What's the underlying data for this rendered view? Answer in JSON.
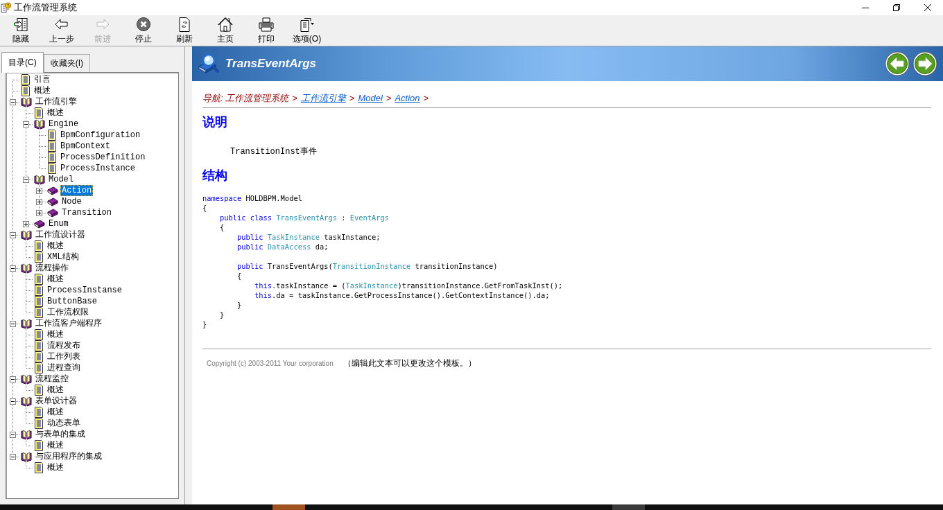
{
  "window": {
    "title": "工作流管理系统"
  },
  "toolbar": [
    {
      "label": "隐藏",
      "kind": "hide",
      "disabled": false
    },
    {
      "label": "上一步",
      "kind": "back",
      "disabled": false
    },
    {
      "label": "前进",
      "kind": "forward",
      "disabled": true
    },
    {
      "label": "停止",
      "kind": "stop",
      "disabled": false
    },
    {
      "label": "刷新",
      "kind": "refresh",
      "disabled": false
    },
    {
      "label": "主页",
      "kind": "home",
      "disabled": false
    },
    {
      "label": "打印",
      "kind": "print",
      "disabled": false
    },
    {
      "label": "选项(O)",
      "kind": "options",
      "disabled": false
    }
  ],
  "nav": {
    "tabs": [
      {
        "label": "目录(C)",
        "selected": true
      },
      {
        "label": "收藏夹(I)",
        "selected": false
      }
    ],
    "tree": [
      {
        "label": "引言",
        "kind": "page",
        "selected": false
      },
      {
        "label": "概述",
        "kind": "page",
        "selected": false
      },
      {
        "label": "工作流引擎",
        "kind": "book",
        "expanded": true,
        "selected": false,
        "children": [
          {
            "label": "概述",
            "kind": "page",
            "selected": false
          },
          {
            "label": "Engine",
            "kind": "book",
            "expanded": true,
            "selected": false,
            "children": [
              {
                "label": "BpmConfiguration",
                "kind": "page",
                "selected": false
              },
              {
                "label": "BpmContext",
                "kind": "page",
                "selected": false
              },
              {
                "label": "ProcessDefinition",
                "kind": "page",
                "selected": false
              },
              {
                "label": "ProcessInstance",
                "kind": "page",
                "selected": false
              }
            ]
          },
          {
            "label": "Model",
            "kind": "book",
            "expanded": true,
            "selected": false,
            "children": [
              {
                "label": "Action",
                "kind": "book",
                "expanded": false,
                "selected": true
              },
              {
                "label": "Node",
                "kind": "book",
                "expanded": false,
                "selected": false
              },
              {
                "label": "Transition",
                "kind": "book",
                "expanded": false,
                "selected": false
              }
            ]
          },
          {
            "label": "Enum",
            "kind": "book",
            "expanded": false,
            "selected": false
          }
        ]
      },
      {
        "label": "工作流设计器",
        "kind": "book",
        "expanded": true,
        "selected": false,
        "children": [
          {
            "label": "概述",
            "kind": "page",
            "selected": false
          },
          {
            "label": "XML结构",
            "kind": "page",
            "selected": false
          }
        ]
      },
      {
        "label": "流程操作",
        "kind": "book",
        "expanded": true,
        "selected": false,
        "children": [
          {
            "label": "概述",
            "kind": "page",
            "selected": false
          },
          {
            "label": "ProcessInstanse",
            "kind": "page",
            "selected": false
          },
          {
            "label": "ButtonBase",
            "kind": "page",
            "selected": false
          },
          {
            "label": "工作流权限",
            "kind": "page",
            "selected": false
          }
        ]
      },
      {
        "label": "工作流客户端程序",
        "kind": "book",
        "expanded": true,
        "selected": false,
        "children": [
          {
            "label": "概述",
            "kind": "page",
            "selected": false
          },
          {
            "label": "流程发布",
            "kind": "page",
            "selected": false
          },
          {
            "label": "工作列表",
            "kind": "page",
            "selected": false
          },
          {
            "label": "进程查询",
            "kind": "page",
            "selected": false
          }
        ]
      },
      {
        "label": "流程监控",
        "kind": "book",
        "expanded": true,
        "selected": false,
        "children": [
          {
            "label": "概述",
            "kind": "page",
            "selected": false
          }
        ]
      },
      {
        "label": "表单设计器",
        "kind": "book",
        "expanded": true,
        "selected": false,
        "children": [
          {
            "label": "概述",
            "kind": "page",
            "selected": false
          },
          {
            "label": "动态表单",
            "kind": "page",
            "selected": false
          }
        ]
      },
      {
        "label": "与表单的集成",
        "kind": "book",
        "expanded": true,
        "selected": false,
        "children": [
          {
            "label": "概述",
            "kind": "page",
            "selected": false
          }
        ]
      },
      {
        "label": "与应用程序的集成",
        "kind": "book",
        "expanded": true,
        "selected": false,
        "children": [
          {
            "label": "概述",
            "kind": "page",
            "selected": false
          }
        ]
      }
    ]
  },
  "topic": {
    "title": "TransEventArgs",
    "breadcrumb": [
      {
        "text": "导航: 工作流管理系统",
        "kind": "text"
      },
      {
        "text": ">",
        "kind": "separator"
      },
      {
        "text": "工作流引擎",
        "kind": "link"
      },
      {
        "text": ">",
        "kind": "separator"
      },
      {
        "text": "Model",
        "kind": "link"
      },
      {
        "text": ">",
        "kind": "separator"
      },
      {
        "text": "Action",
        "kind": "link"
      },
      {
        "text": ">",
        "kind": "separator"
      }
    ],
    "sections": [
      {
        "heading": "说明",
        "kind": "text",
        "text": "TransitionInst事件"
      },
      {
        "heading": "结构",
        "kind": "code",
        "lines": [
          {
            "kind": "code",
            "tokens": [
              {
                "t": "namespace",
                "kind": "keyword"
              },
              {
                "t": " HOLDBPM.Model",
                "kind": "plain"
              }
            ]
          },
          {
            "kind": "code",
            "tokens": [
              {
                "t": "{",
                "kind": "plain"
              }
            ]
          },
          {
            "kind": "code",
            "tokens": [
              {
                "t": "    public class",
                "kind": "keyword"
              },
              {
                "t": " TransEventArgs",
                "kind": "type"
              },
              {
                "t": " : ",
                "kind": "plain"
              },
              {
                "t": "EventArgs",
                "kind": "type"
              }
            ]
          },
          {
            "kind": "code",
            "tokens": [
              {
                "t": "    {",
                "kind": "plain"
              }
            ]
          },
          {
            "kind": "code",
            "tokens": [
              {
                "t": "        public",
                "kind": "keyword"
              },
              {
                "t": " TaskInstance",
                "kind": "type"
              },
              {
                "t": " taskInstance;",
                "kind": "plain"
              }
            ]
          },
          {
            "kind": "code",
            "tokens": [
              {
                "t": "        public",
                "kind": "keyword"
              },
              {
                "t": " DataAccess",
                "kind": "type"
              },
              {
                "t": " da;",
                "kind": "plain"
              }
            ]
          },
          {
            "kind": "blank"
          },
          {
            "kind": "code",
            "tokens": [
              {
                "t": "        public",
                "kind": "keyword"
              },
              {
                "t": " TransEventArgs(",
                "kind": "plain"
              },
              {
                "t": "TransitionInstance",
                "kind": "type"
              },
              {
                "t": " transitionInstance)",
                "kind": "plain"
              }
            ]
          },
          {
            "kind": "code",
            "tokens": [
              {
                "t": "        {",
                "kind": "plain"
              }
            ]
          },
          {
            "kind": "code",
            "tokens": [
              {
                "t": "            this",
                "kind": "keyword"
              },
              {
                "t": ".taskInstance = (",
                "kind": "plain"
              },
              {
                "t": "TaskInstance",
                "kind": "type"
              },
              {
                "t": ")transitionInstance.GetFromTaskInst();",
                "kind": "plain"
              }
            ]
          },
          {
            "kind": "code",
            "tokens": [
              {
                "t": "            this",
                "kind": "keyword"
              },
              {
                "t": ".da = taskInstance.GetProcessInstance().GetContextInstance().da;",
                "kind": "plain"
              }
            ]
          },
          {
            "kind": "code",
            "tokens": [
              {
                "t": "        }",
                "kind": "plain"
              }
            ]
          },
          {
            "kind": "code",
            "tokens": [
              {
                "t": "    }",
                "kind": "plain"
              }
            ]
          },
          {
            "kind": "code",
            "tokens": [
              {
                "t": "}",
                "kind": "plain"
              }
            ]
          }
        ]
      }
    ],
    "footer": {
      "copyright": "Copyright (c) 2003-2011 Your corporation",
      "note": "（编辑此文本可以更改这个模板。）"
    }
  }
}
